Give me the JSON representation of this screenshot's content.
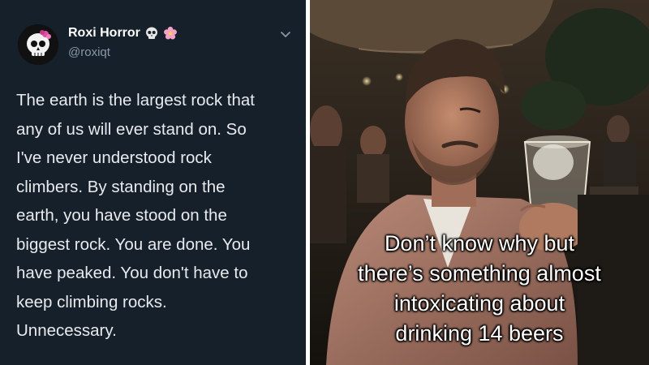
{
  "tweet": {
    "display_name": "Roxi Horror",
    "handle": "@roxiqt",
    "badges": [
      "skull-emoji",
      "cherry-blossom-emoji"
    ],
    "lines": [
      "The earth is the largest rock that",
      "any of us will ever stand on. So",
      "I've never understood rock",
      "climbers. By standing on the",
      "earth, you have stood on the",
      "biggest rock. You are done. You",
      "have peaked. You don't have to",
      "keep climbing rocks.",
      "Unnecessary."
    ],
    "menu_icon": "chevron-down-icon"
  },
  "photo": {
    "caption_lines": [
      "Don’t know why but",
      "there’s something almost",
      "intoxicating about",
      "drinking 14 beers"
    ]
  },
  "colors": {
    "tweet_bg": "#15202b",
    "tweet_text": "#e8eaed",
    "handle": "#8899a6"
  }
}
